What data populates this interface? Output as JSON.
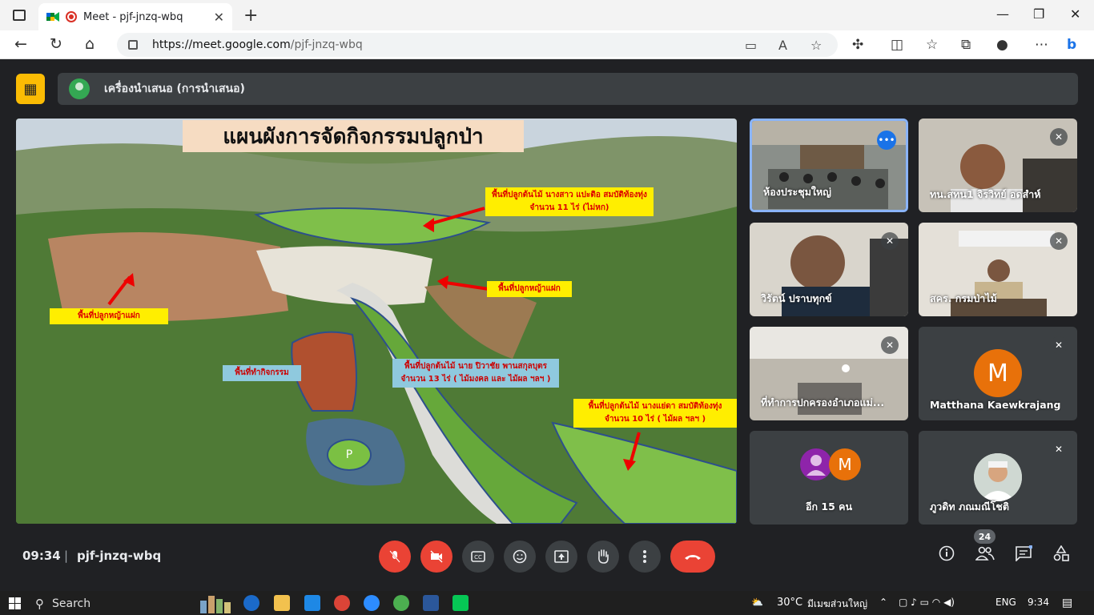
{
  "browser": {
    "tab_title": "Meet - pjf-jnzq-wbq",
    "tab_close": "✕",
    "new_tab": "+",
    "url_host": "https://meet.google.com",
    "url_path": "/pjf-jnzq-wbq",
    "window_controls": {
      "minimize": "—",
      "maximize": "❐",
      "close": "✕"
    }
  },
  "meet": {
    "presenting_label": "เครื่องนำเสนอ (การนำเสนอ)",
    "slide": {
      "title": "แผนผังการจัดกิจกรรมปลูกป่า",
      "labels": [
        "พื้นที่ปลูกต้นไม้ นางสาว แปะติอ สมบัติท้องทุ่ง จำนวน 11 ไร่ (ไม่หก)",
        "พื้นที่ปลูกหญ้าแฝก",
        "พื้นที่ปลูกหญ้าแฝก",
        "พื้นที่ทำกิจกรรม",
        "พื้นที่ปลูกต้นไม้ นาย ปิวาชัย พานสกุลบุตร จำนวน 13 ไร่ ( ไม้มงคล และ ไม้ผล ฯลฯ )",
        "พื้นที่ปลูกต้นไม้ นางแย่ดา สมบัติท้องทุ่ง จำนวน 10 ไร่ ( ไม้ผล ฯลฯ )",
        "P"
      ]
    },
    "participants": [
      "ห้องประชุมใหญ่",
      "ทน.สทน1 จิรวิทย์ อดสำห์",
      "วิรัตน์ ปราบทุกข์",
      "สคร. กรมป่าไม้",
      "ที่ทำการปกครองอำเภอแม่...",
      "Matthana Kaewkrajang",
      "อีก 15 คน",
      "ภูวดิท ภณมณีโชติ"
    ],
    "avatar_letter": "M",
    "time": "09:34",
    "separator": "|",
    "meeting_code": "pjf-jnzq-wbq",
    "participant_count": "24",
    "more_dots": "•••"
  },
  "taskbar": {
    "search_label": "Search",
    "weather": "30°C",
    "weather_text": "มีเมฆส่วนใหญ่",
    "language": "ENG",
    "clock": "9:34"
  },
  "colors": {
    "meet_bg": "#202124",
    "present_badge": "#fbbc04",
    "end_call": "#ea4335",
    "active_tile_border": "#8ab4f8",
    "avatar_orange": "#e8710a"
  }
}
